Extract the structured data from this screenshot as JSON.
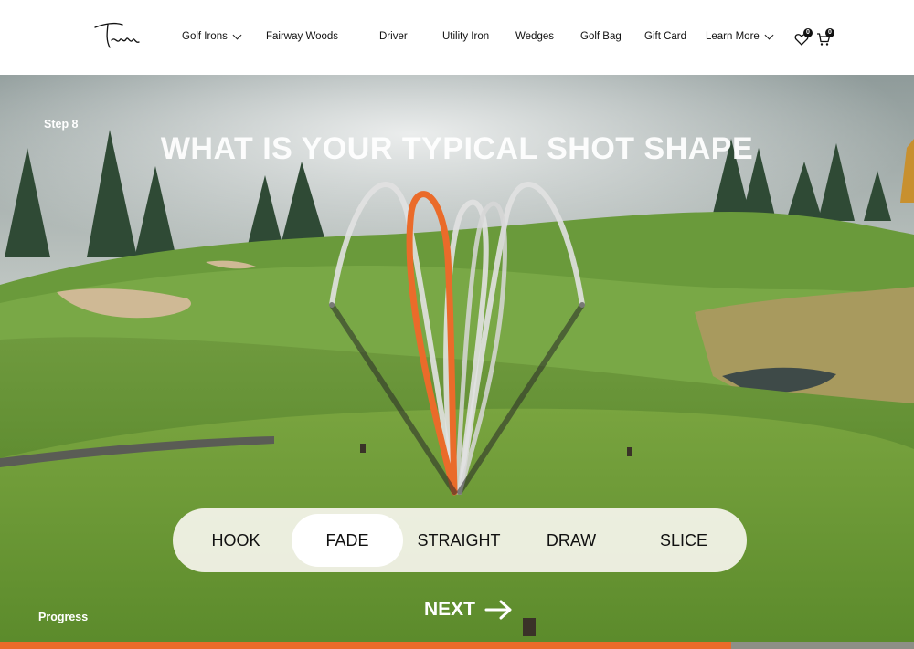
{
  "brand": {
    "logo_text": "Takomo",
    "icon": "signature-logo"
  },
  "nav": {
    "items": [
      {
        "label": "Golf Irons",
        "dropdown": true
      },
      {
        "label": "Fairway Woods",
        "dropdown": false
      },
      {
        "label": "Driver",
        "dropdown": false
      },
      {
        "label": "Utility Iron",
        "dropdown": false
      },
      {
        "label": "Wedges",
        "dropdown": false
      },
      {
        "label": "Golf Bag",
        "dropdown": false
      },
      {
        "label": "Gift Card",
        "dropdown": false
      },
      {
        "label": "Learn More",
        "dropdown": true
      }
    ],
    "wishlist": {
      "icon": "heart-icon",
      "count": "0"
    },
    "cart": {
      "icon": "cart-icon",
      "count": "0"
    }
  },
  "quiz": {
    "step_label": "Step 8",
    "question": "WHAT IS YOUR TYPICAL SHOT SHAPE",
    "options": [
      "HOOK",
      "FADE",
      "STRAIGHT",
      "DRAW",
      "SLICE"
    ],
    "selected": "FADE",
    "next_label": "NEXT",
    "next_icon": "arrow-right-icon",
    "progress_label": "Progress",
    "progress_fraction": 0.8
  },
  "colors": {
    "accent": "#ea6b2a",
    "progress_track": "#8d8f86"
  }
}
